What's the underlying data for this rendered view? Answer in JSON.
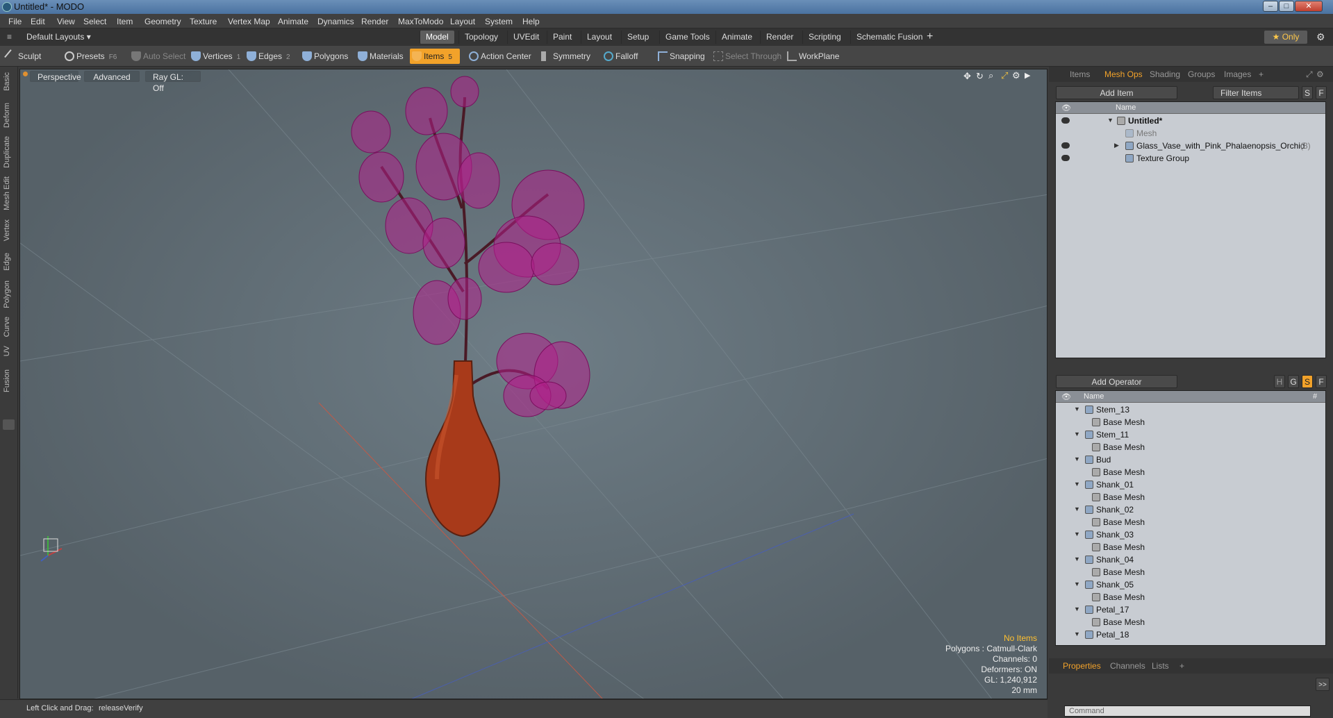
{
  "window": {
    "title": "Untitled* - MODO",
    "buttons": [
      "–",
      "□",
      "✕"
    ]
  },
  "menu": [
    "File",
    "Edit",
    "View",
    "Select",
    "Item",
    "Geometry",
    "Texture",
    "Vertex Map",
    "Animate",
    "Dynamics",
    "Render",
    "MaxToModo",
    "Layout",
    "System",
    "Help"
  ],
  "layout_bar": {
    "layouts": "Default Layouts ▾",
    "tabs": [
      "Model",
      "Topology",
      "UVEdit",
      "Paint",
      "Layout",
      "Setup",
      "Game Tools",
      "Animate",
      "Render",
      "Scripting",
      "Schematic Fusion"
    ],
    "active": "Model",
    "plus": "+",
    "only": "★ Only"
  },
  "toolbar": {
    "sculpt": "Sculpt",
    "presets": "Presets",
    "presets_key": "F6",
    "auto_select": "Auto Select",
    "vertices": "Vertices",
    "vertices_key": "1",
    "edges": "Edges",
    "edges_key": "2",
    "polygons": "Polygons",
    "materials": "Materials",
    "items": "Items",
    "items_key": "5",
    "action_center": "Action Center",
    "symmetry": "Symmetry",
    "falloff": "Falloff",
    "snapping": "Snapping",
    "select_through": "Select Through",
    "workplane": "WorkPlane"
  },
  "left_tabs": [
    "Basic",
    "Deform",
    "Duplicate",
    "Mesh Edit",
    "Vertex",
    "Edge",
    "Polygon",
    "Curve",
    "UV",
    "Fusion"
  ],
  "viewport": {
    "view": "Perspective",
    "shading": "Advanced",
    "raygl": "Ray GL: Off",
    "stats": {
      "selection": "No Items",
      "polygons": "Polygons : Catmull-Clark",
      "channels": "Channels: 0",
      "deformers": "Deformers: ON",
      "gl": "GL: 1,240,912",
      "scale": "20 mm"
    }
  },
  "status": {
    "hint": "Left Click and Drag:",
    "action": "releaseVerify"
  },
  "items_panel": {
    "tabs": [
      "Items",
      "Mesh Ops",
      "Shading",
      "Groups",
      "Images"
    ],
    "active": "Mesh Ops",
    "add_item": "Add Item",
    "filter": "Filter Items",
    "s": "S",
    "f": "F",
    "col_name": "Name",
    "rows": [
      {
        "label": "Untitled*"
      },
      {
        "label": "Mesh"
      },
      {
        "label": "Glass_Vase_with_Pink_Phalaenopsis_Orchid",
        "count": "(3)"
      },
      {
        "label": "Texture Group"
      }
    ]
  },
  "ops_panel": {
    "add_operator": "Add Operator",
    "flags": [
      "H",
      "G",
      "S",
      "F"
    ],
    "col_name": "Name",
    "col_hash": "#",
    "rows": [
      {
        "label": "Stem_13"
      },
      {
        "label": "Base Mesh"
      },
      {
        "label": "Stem_11"
      },
      {
        "label": "Base Mesh"
      },
      {
        "label": "Bud"
      },
      {
        "label": "Base Mesh"
      },
      {
        "label": "Shank_01"
      },
      {
        "label": "Base Mesh"
      },
      {
        "label": "Shank_02"
      },
      {
        "label": "Base Mesh"
      },
      {
        "label": "Shank_03"
      },
      {
        "label": "Base Mesh"
      },
      {
        "label": "Shank_04"
      },
      {
        "label": "Base Mesh"
      },
      {
        "label": "Shank_05"
      },
      {
        "label": "Base Mesh"
      },
      {
        "label": "Petal_17"
      },
      {
        "label": "Base Mesh"
      },
      {
        "label": "Petal_18"
      }
    ]
  },
  "bottom_panel": {
    "tabs": [
      "Properties",
      "Channels",
      "Lists"
    ],
    "active": "Properties",
    "expand": ">>",
    "command_placeholder": "Command"
  }
}
